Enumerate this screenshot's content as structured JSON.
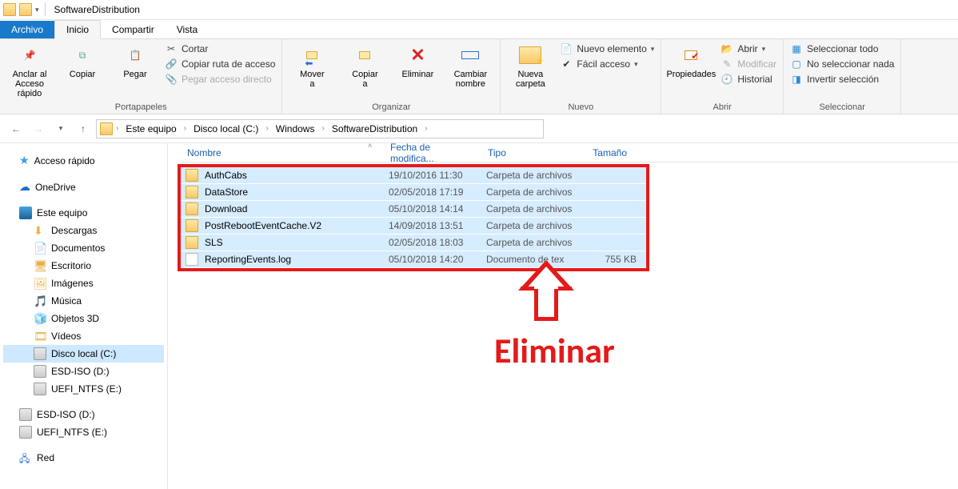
{
  "window": {
    "title": "SoftwareDistribution"
  },
  "tabs": {
    "file": "Archivo",
    "home": "Inicio",
    "share": "Compartir",
    "view": "Vista"
  },
  "ribbon": {
    "pin": "Anclar al\nAcceso rápido",
    "copy": "Copiar",
    "paste": "Pegar",
    "cut": "Cortar",
    "copy_path": "Copiar ruta de acceso",
    "paste_shortcut": "Pegar acceso directo",
    "clipboard_group": "Portapapeles",
    "move": "Mover\na",
    "copy_to": "Copiar\na",
    "delete": "Eliminar",
    "rename": "Cambiar\nnombre",
    "organize_group": "Organizar",
    "new_folder": "Nueva\ncarpeta",
    "new_item": "Nuevo elemento",
    "easy_access": "Fácil acceso",
    "new_group": "Nuevo",
    "properties": "Propiedades",
    "open": "Abrir",
    "edit": "Modificar",
    "history": "Historial",
    "open_group": "Abrir",
    "select_all": "Seleccionar todo",
    "select_none": "No seleccionar nada",
    "invert": "Invertir selección",
    "select_group": "Seleccionar"
  },
  "breadcrumbs": [
    "Este equipo",
    "Disco local (C:)",
    "Windows",
    "SoftwareDistribution"
  ],
  "columns": {
    "name": "Nombre",
    "date": "Fecha de modifica...",
    "type": "Tipo",
    "size": "Tamaño"
  },
  "tree": {
    "quick": "Acceso rápido",
    "onedrive": "OneDrive",
    "pc": "Este equipo",
    "pc_children": [
      "Descargas",
      "Documentos",
      "Escritorio",
      "Imágenes",
      "Música",
      "Objetos 3D",
      "Vídeos",
      "Disco local (C:)",
      "ESD-ISO (D:)",
      "UEFI_NTFS (E:)"
    ],
    "extra": [
      "ESD-ISO (D:)",
      "UEFI_NTFS (E:)"
    ],
    "network": "Red"
  },
  "files": [
    {
      "name": "AuthCabs",
      "date": "19/10/2016 11:30",
      "type": "Carpeta de archivos",
      "size": "",
      "icon": "folder"
    },
    {
      "name": "DataStore",
      "date": "02/05/2018 17:19",
      "type": "Carpeta de archivos",
      "size": "",
      "icon": "folder"
    },
    {
      "name": "Download",
      "date": "05/10/2018 14:14",
      "type": "Carpeta de archivos",
      "size": "",
      "icon": "folder"
    },
    {
      "name": "PostRebootEventCache.V2",
      "date": "14/09/2018 13:51",
      "type": "Carpeta de archivos",
      "size": "",
      "icon": "folder"
    },
    {
      "name": "SLS",
      "date": "02/05/2018 18:03",
      "type": "Carpeta de archivos",
      "size": "",
      "icon": "folder"
    },
    {
      "name": "ReportingEvents.log",
      "date": "05/10/2018 14:20",
      "type": "Documento de tex",
      "size": "755 KB",
      "icon": "file"
    }
  ],
  "annotation": "Eliminar"
}
